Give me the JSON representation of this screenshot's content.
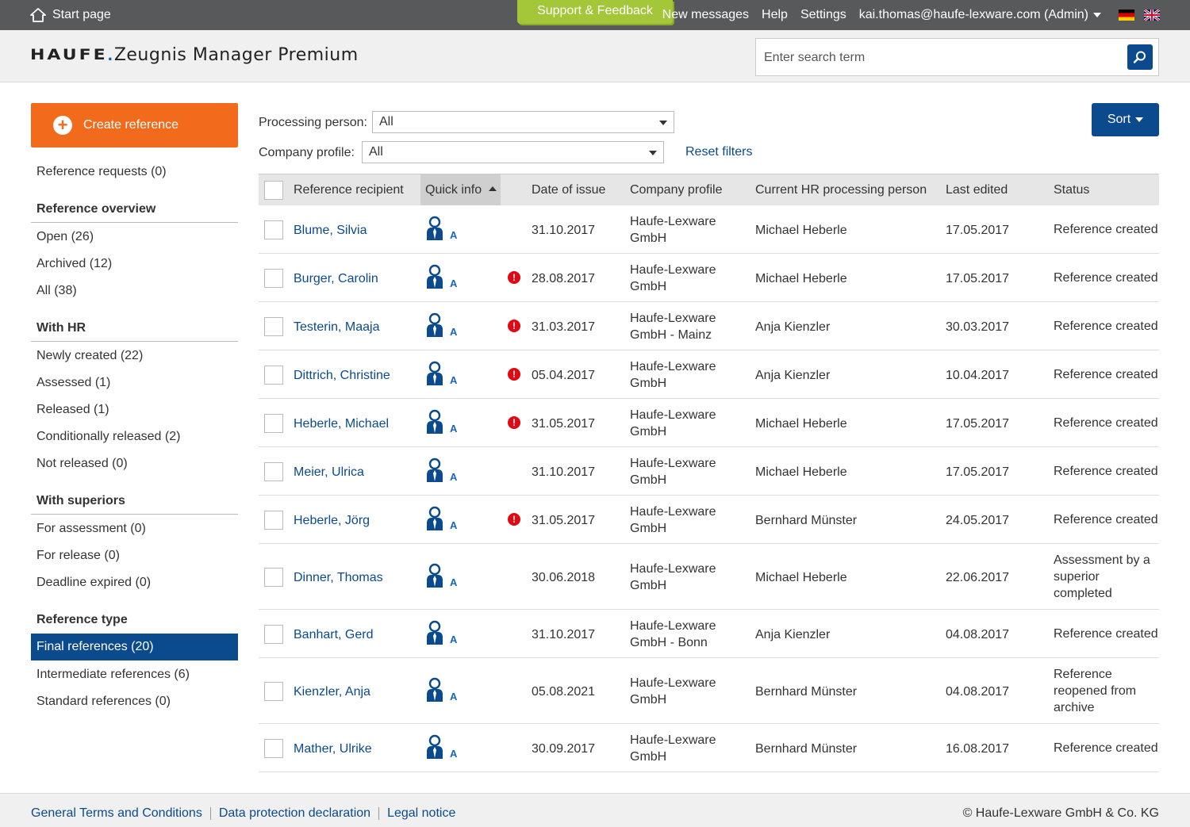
{
  "topbar": {
    "start_label": "Start page",
    "support_label": "Support & Feedback",
    "new_messages": "New messages",
    "help": "Help",
    "settings": "Settings",
    "user": "kai.thomas@haufe-lexware.com (Admin)"
  },
  "header": {
    "brand": "HAUFE",
    "product": "Zeugnis Manager Premium",
    "search_placeholder": "Enter search term"
  },
  "sidebar": {
    "create_label": "Create reference",
    "reference_requests": "Reference requests (0)",
    "sections": [
      {
        "title": "Reference overview",
        "items": [
          "Open (26)",
          "Archived (12)",
          "All (38)"
        ]
      },
      {
        "title": "With HR",
        "items": [
          "Newly created (22)",
          "Assessed (1)",
          "Released (1)",
          "Conditionally released (2)",
          "Not released (0)"
        ]
      },
      {
        "title": "With superiors",
        "items": [
          "For assessment (0)",
          "For release (0)",
          "Deadline expired (0)"
        ]
      },
      {
        "title": "Reference type",
        "items": [
          "Final references (20)",
          "Intermediate references (6)",
          "Standard references (0)"
        ]
      }
    ]
  },
  "filters": {
    "processing_label": "Processing person:",
    "processing_value": "All",
    "company_label": "Company profile:",
    "company_value": "All",
    "reset_label": "Reset filters",
    "sort_label": "Sort"
  },
  "table": {
    "headers": [
      "Reference recipient",
      "Quick info",
      "Date of issue",
      "Company profile",
      "Current HR processing person",
      "Last edited",
      "Status"
    ],
    "quick_label": "A",
    "rows": [
      {
        "name": "Blume, Silvia",
        "warn": false,
        "date": "31.10.2017",
        "company": [
          "Haufe-Lexware",
          "GmbH"
        ],
        "person": "Michael Heberle",
        "edited": "17.05.2017",
        "status": [
          "Reference created"
        ]
      },
      {
        "name": "Burger, Carolin",
        "warn": true,
        "date": "28.08.2017",
        "company": [
          "Haufe-Lexware",
          "GmbH"
        ],
        "person": "Michael Heberle",
        "edited": "17.05.2017",
        "status": [
          "Reference created"
        ]
      },
      {
        "name": "Testerin, Maaja",
        "warn": true,
        "date": "31.03.2017",
        "company": [
          "Haufe-Lexware",
          "GmbH - Mainz"
        ],
        "person": "Anja Kienzler",
        "edited": "30.03.2017",
        "status": [
          "Reference created"
        ]
      },
      {
        "name": "Dittrich, Christine",
        "warn": true,
        "date": "05.04.2017",
        "company": [
          "Haufe-Lexware",
          "GmbH"
        ],
        "person": "Anja Kienzler",
        "edited": "10.04.2017",
        "status": [
          "Reference created"
        ]
      },
      {
        "name": "Heberle, Michael",
        "warn": true,
        "date": "31.05.2017",
        "company": [
          "Haufe-Lexware",
          "GmbH"
        ],
        "person": "Michael Heberle",
        "edited": "17.05.2017",
        "status": [
          "Reference created"
        ]
      },
      {
        "name": "Meier, Ulrica",
        "warn": false,
        "date": "31.10.2017",
        "company": [
          "Haufe-Lexware",
          "GmbH"
        ],
        "person": "Michael Heberle",
        "edited": "17.05.2017",
        "status": [
          "Reference created"
        ]
      },
      {
        "name": "Heberle, Jörg",
        "warn": true,
        "date": "31.05.2017",
        "company": [
          "Haufe-Lexware",
          "GmbH"
        ],
        "person": "Bernhard Münster",
        "edited": "24.05.2017",
        "status": [
          "Reference created"
        ]
      },
      {
        "name": "Dinner, Thomas",
        "warn": false,
        "date": "30.06.2018",
        "company": [
          "Haufe-Lexware",
          "GmbH"
        ],
        "person": "Michael Heberle",
        "edited": "22.06.2017",
        "status": [
          "Assessment by a",
          "superior",
          "completed"
        ]
      },
      {
        "name": "Banhart, Gerd",
        "warn": false,
        "date": "31.10.2017",
        "company": [
          "Haufe-Lexware",
          "GmbH - Bonn"
        ],
        "person": "Anja Kienzler",
        "edited": "04.08.2017",
        "status": [
          "Reference created"
        ]
      },
      {
        "name": "Kienzler, Anja",
        "warn": false,
        "date": "05.08.2021",
        "company": [
          "Haufe-Lexware",
          "GmbH"
        ],
        "person": "Bernhard Münster",
        "edited": "04.08.2017",
        "status": [
          "Reference",
          "reopened from",
          "archive"
        ]
      },
      {
        "name": "Mather, Ulrike",
        "warn": false,
        "date": "30.09.2017",
        "company": [
          "Haufe-Lexware",
          "GmbH"
        ],
        "person": "Bernhard Münster",
        "edited": "16.08.2017",
        "status": [
          "Reference created"
        ]
      }
    ]
  },
  "footer": {
    "links": [
      "General Terms and Conditions",
      "Data protection declaration",
      "Legal notice"
    ],
    "copyright": "© Haufe-Lexware GmbH & Co. KG"
  },
  "colors": {
    "accent_orange": "#f26b1d",
    "primary_blue": "#0b4a8c",
    "support_green": "#a4c639",
    "warning_red": "#e30613"
  }
}
